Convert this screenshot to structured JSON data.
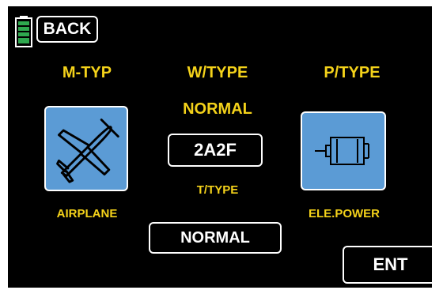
{
  "header": {
    "battery_icon": "battery-icon",
    "back_label": "BACK"
  },
  "columns": {
    "model_type": {
      "heading": "M-TYP",
      "icon": "airplane-icon",
      "value": "AIRPLANE"
    },
    "wing_type": {
      "heading": "W/TYPE",
      "value": "NORMAL",
      "selector_value": "2A2F"
    },
    "tail_type": {
      "heading": "T/TYPE",
      "value": "NORMAL"
    },
    "power_type": {
      "heading": "P/TYPE",
      "icon": "electric-motor-icon",
      "value": "ELE.POWER"
    }
  },
  "footer": {
    "enter_label": "ENT"
  },
  "colors": {
    "background": "#000000",
    "heading_yellow": "#f4d21a",
    "tile_blue": "#5b9bd5",
    "battery_green": "#2fa84f",
    "foreground": "#ffffff"
  }
}
